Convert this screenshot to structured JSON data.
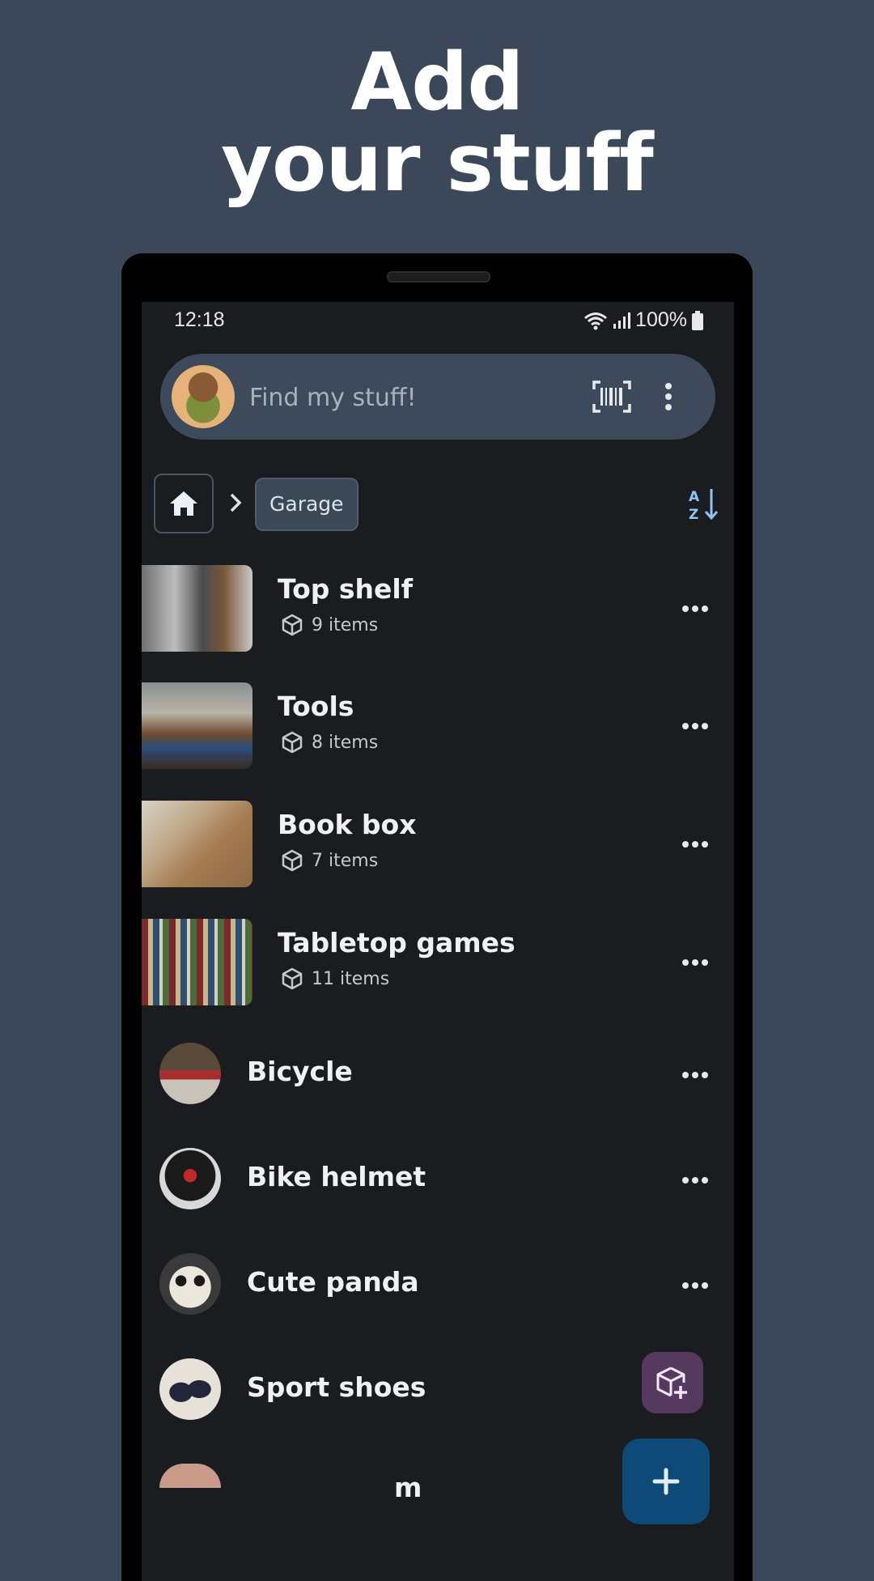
{
  "headline": {
    "line1": "Add",
    "line2": "your stuff"
  },
  "statusbar": {
    "time": "12:18",
    "battery": "100%"
  },
  "search": {
    "placeholder": "Find my stuff!"
  },
  "icons": {
    "avatar": "avatar-image",
    "barcode": "barcode-scan-icon",
    "more": "more-vert-icon",
    "home": "home-icon",
    "chevron": "chevron-right-icon",
    "sort": "sort-az-icon",
    "box": "box-icon",
    "row_more": "more-horiz-icon",
    "add_location": "add-box-icon",
    "add": "plus-icon"
  },
  "breadcrumb": {
    "current": "Garage"
  },
  "containers": [
    {
      "name": "Top shelf",
      "count": "9 items"
    },
    {
      "name": "Tools",
      "count": "8 items"
    },
    {
      "name": "Book box",
      "count": "7 items"
    },
    {
      "name": "Tabletop games",
      "count": "11 items"
    }
  ],
  "items": [
    {
      "name": "Bicycle"
    },
    {
      "name": "Bike helmet"
    },
    {
      "name": "Cute panda"
    },
    {
      "name": "Sport shoes"
    },
    {
      "name": "m"
    }
  ],
  "colors": {
    "background": "#3b4859",
    "screen": "#1b1c1f",
    "searchbar": "#3d4a5b",
    "accent_blue": "#8fc4f2",
    "fab_primary": "#0d4a78",
    "fab_secondary": "#56395f"
  }
}
